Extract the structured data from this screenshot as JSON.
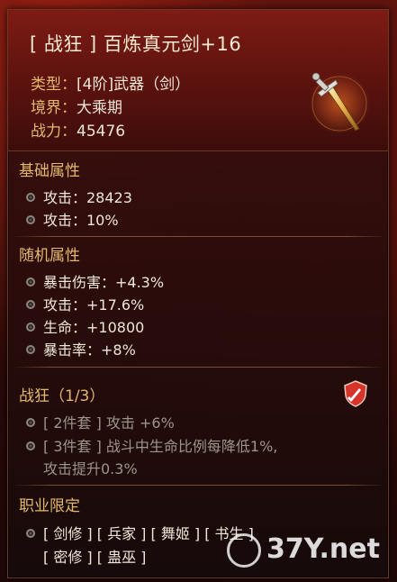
{
  "item": {
    "title": "[ 战狂 ] 百炼真元剑+16",
    "type_label": "类型：",
    "type_value": "[4阶]武器（剑）",
    "realm_label": "境界：",
    "realm_value": "大乘期",
    "power_label": "战力：",
    "power_value": "45476",
    "icon": "sword-icon"
  },
  "base_attrs": {
    "title": "基础属性",
    "rows": [
      "攻击：28423",
      "攻击：10%"
    ]
  },
  "random_attrs": {
    "title": "随机属性",
    "rows": [
      "暴击伤害：+4.3%",
      "攻击：+17.6%",
      "生命：+10800",
      "暴击率：+8%"
    ]
  },
  "set_bonus": {
    "title": "战狂（1/3）",
    "icon": "shield-sword-icon",
    "rows": [
      "[ 2件套 ] 攻击 +6%",
      "[ 3件套 ] 战斗中生命比例每降低1%,",
      "攻击提升0.3%"
    ]
  },
  "class_limit": {
    "title": "职业限定",
    "line1": "[ 剑修 ] [ 兵家 ] [ 舞姬 ] [ 书生 ]",
    "line2": "[ 密修 ] [ 蛊巫 ]"
  },
  "watermark": {
    "text": "37Y.net"
  },
  "colors": {
    "accent_gold": "#e2b86d",
    "text_light": "#efe6d8",
    "text_dim": "#9d948a",
    "header_red": "#7e1b14"
  }
}
